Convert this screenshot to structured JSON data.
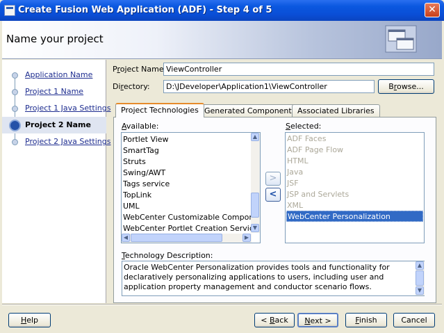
{
  "window": {
    "title": "Create Fusion Web Application (ADF) - Step 4 of 5",
    "close_glyph": "✕"
  },
  "header": {
    "title": "Name your project",
    "art_icon": "wizard-windows-icon"
  },
  "nav": {
    "items": [
      {
        "label": "Application Name",
        "state": "visited"
      },
      {
        "label": "Project 1 Name",
        "state": "visited"
      },
      {
        "label": "Project 1 Java Settings",
        "state": "visited"
      },
      {
        "label": "Project 2 Name",
        "state": "current"
      },
      {
        "label": "Project 2 Java Settings",
        "state": "pending"
      }
    ]
  },
  "form": {
    "project_name_label_pre": "P",
    "project_name_label_ul": "r",
    "project_name_label_post": "oject Name:",
    "project_name_value": "ViewController",
    "directory_label_pre": "Di",
    "directory_label_ul": "r",
    "directory_label_post": "ectory:",
    "directory_value": "D:\\JDeveloper\\Application1\\ViewController",
    "browse_label_pre": "B",
    "browse_label_ul": "r",
    "browse_label_post": "owse..."
  },
  "tabs": [
    {
      "label": "Project Technologies",
      "active": true
    },
    {
      "label": "Generated Components",
      "active": false
    },
    {
      "label": "Associated Libraries",
      "active": false
    }
  ],
  "available": {
    "label_ul": "A",
    "label_post": "vailable:",
    "items": [
      "Portlet View",
      "SmartTag",
      "Struts",
      "Swing/AWT",
      "Tags service",
      "TopLink",
      "UML",
      "WebCenter Customizable Components",
      "WebCenter Portlet Creation Service"
    ]
  },
  "selected": {
    "label_ul": "S",
    "label_post": "elected:",
    "items": [
      {
        "label": "ADF Faces",
        "state": "disabled"
      },
      {
        "label": "ADF Page Flow",
        "state": "disabled"
      },
      {
        "label": "HTML",
        "state": "disabled"
      },
      {
        "label": "Java",
        "state": "disabled"
      },
      {
        "label": "JSF",
        "state": "disabled"
      },
      {
        "label": "JSP and Servlets",
        "state": "disabled"
      },
      {
        "label": "XML",
        "state": "disabled"
      },
      {
        "label": "WebCenter Personalization",
        "state": "selected"
      }
    ]
  },
  "move": {
    "add_glyph": ">",
    "remove_glyph": "<"
  },
  "description": {
    "label_ul": "T",
    "label_post": "echnology Description:",
    "text": "Oracle WebCenter Personalization provides tools and functionality for declaratively personalizing applications to users, including user and application property management and conductor scenario flows."
  },
  "footer": {
    "help_ul": "H",
    "help_post": "elp",
    "back_pre": "< ",
    "back_ul": "B",
    "back_post": "ack",
    "next_ul": "N",
    "next_post": "ext >",
    "finish_ul": "F",
    "finish_post": "inish",
    "cancel_label": "Cancel"
  },
  "scroll": {
    "up": "▲",
    "down": "▼",
    "left": "◀",
    "right": "▶"
  },
  "colors": {
    "titlebar": "#0b58e0",
    "selection": "#316ac5",
    "link": "#1d2c8f",
    "tab_accent": "#e68b2c"
  }
}
